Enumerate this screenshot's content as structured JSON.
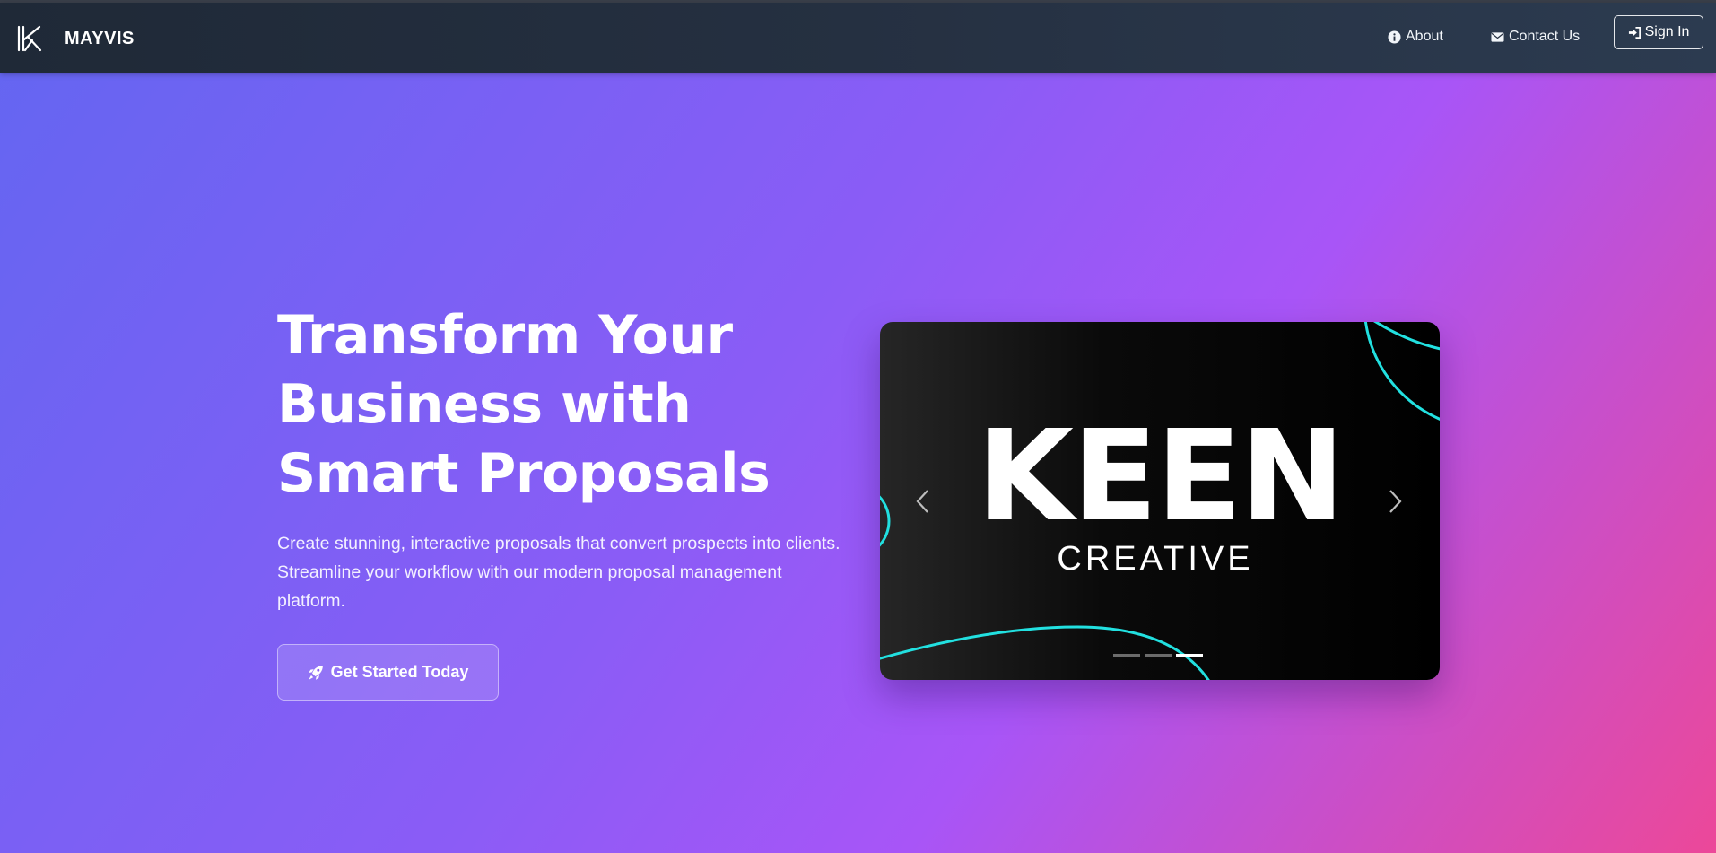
{
  "colors": {
    "navbar": "#1f2937",
    "gradient_start": "#6366f1",
    "gradient_mid": "#8b5cf6",
    "gradient_end": "#ec4899",
    "accent_cyan": "#22e0e0"
  },
  "navbar": {
    "brand_icon": "brand-k-logo-icon",
    "brand_name": "MAYVIS",
    "links": {
      "about": {
        "icon": "info-circle-icon",
        "label": "About"
      },
      "contact": {
        "icon": "envelope-icon",
        "label": "Contact Us"
      }
    },
    "signin": {
      "icon": "sign-in-icon",
      "label": "Sign In"
    }
  },
  "hero": {
    "title_lines": [
      "Transform Your",
      "Business with",
      "Smart Proposals"
    ],
    "subtitle": "Create stunning, interactive proposals that convert prospects into clients. Streamline your workflow with our modern proposal management platform.",
    "cta": {
      "icon": "rocket-icon",
      "label": "Get Started Today"
    }
  },
  "carousel": {
    "slide": {
      "headline": "KEEN",
      "subheadline": "CREATIVE"
    },
    "prev_icon": "chevron-left-icon",
    "next_icon": "chevron-right-icon",
    "slide_count": 3,
    "active_index": 2
  }
}
